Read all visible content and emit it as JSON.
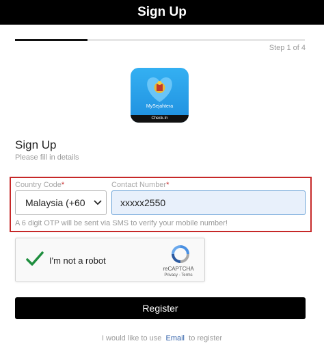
{
  "header": {
    "title": "Sign Up"
  },
  "progress": {
    "fraction": 0.25,
    "step_label": "Step 1 of 4"
  },
  "app": {
    "name": "MySejahtera",
    "subtitle": "Check-In"
  },
  "form": {
    "title": "Sign Up",
    "subtitle": "Please fill in details",
    "country_label": "Country Code",
    "country_value": "Malaysia (+60",
    "contact_label": "Contact Number",
    "contact_value": "xxxxx2550",
    "required_mark": "*",
    "otp_hint": "A 6 digit OTP will be sent via SMS to verify your mobile number!"
  },
  "captcha": {
    "label": "I'm not a robot",
    "brand": "reCAPTCHA",
    "terms": "Privacy - Terms"
  },
  "actions": {
    "register_label": "Register"
  },
  "footer": {
    "prefix": "I would like to use",
    "link": "Email",
    "suffix": "to register"
  },
  "colors": {
    "highlight": "#c62828",
    "check": "#1e8e3e",
    "link": "#2f5fa8",
    "icon_blue": "#2a9fe9"
  },
  "icons": [
    "chevron-down-icon",
    "checkmark-icon",
    "recaptcha-icon",
    "heart-icon"
  ]
}
